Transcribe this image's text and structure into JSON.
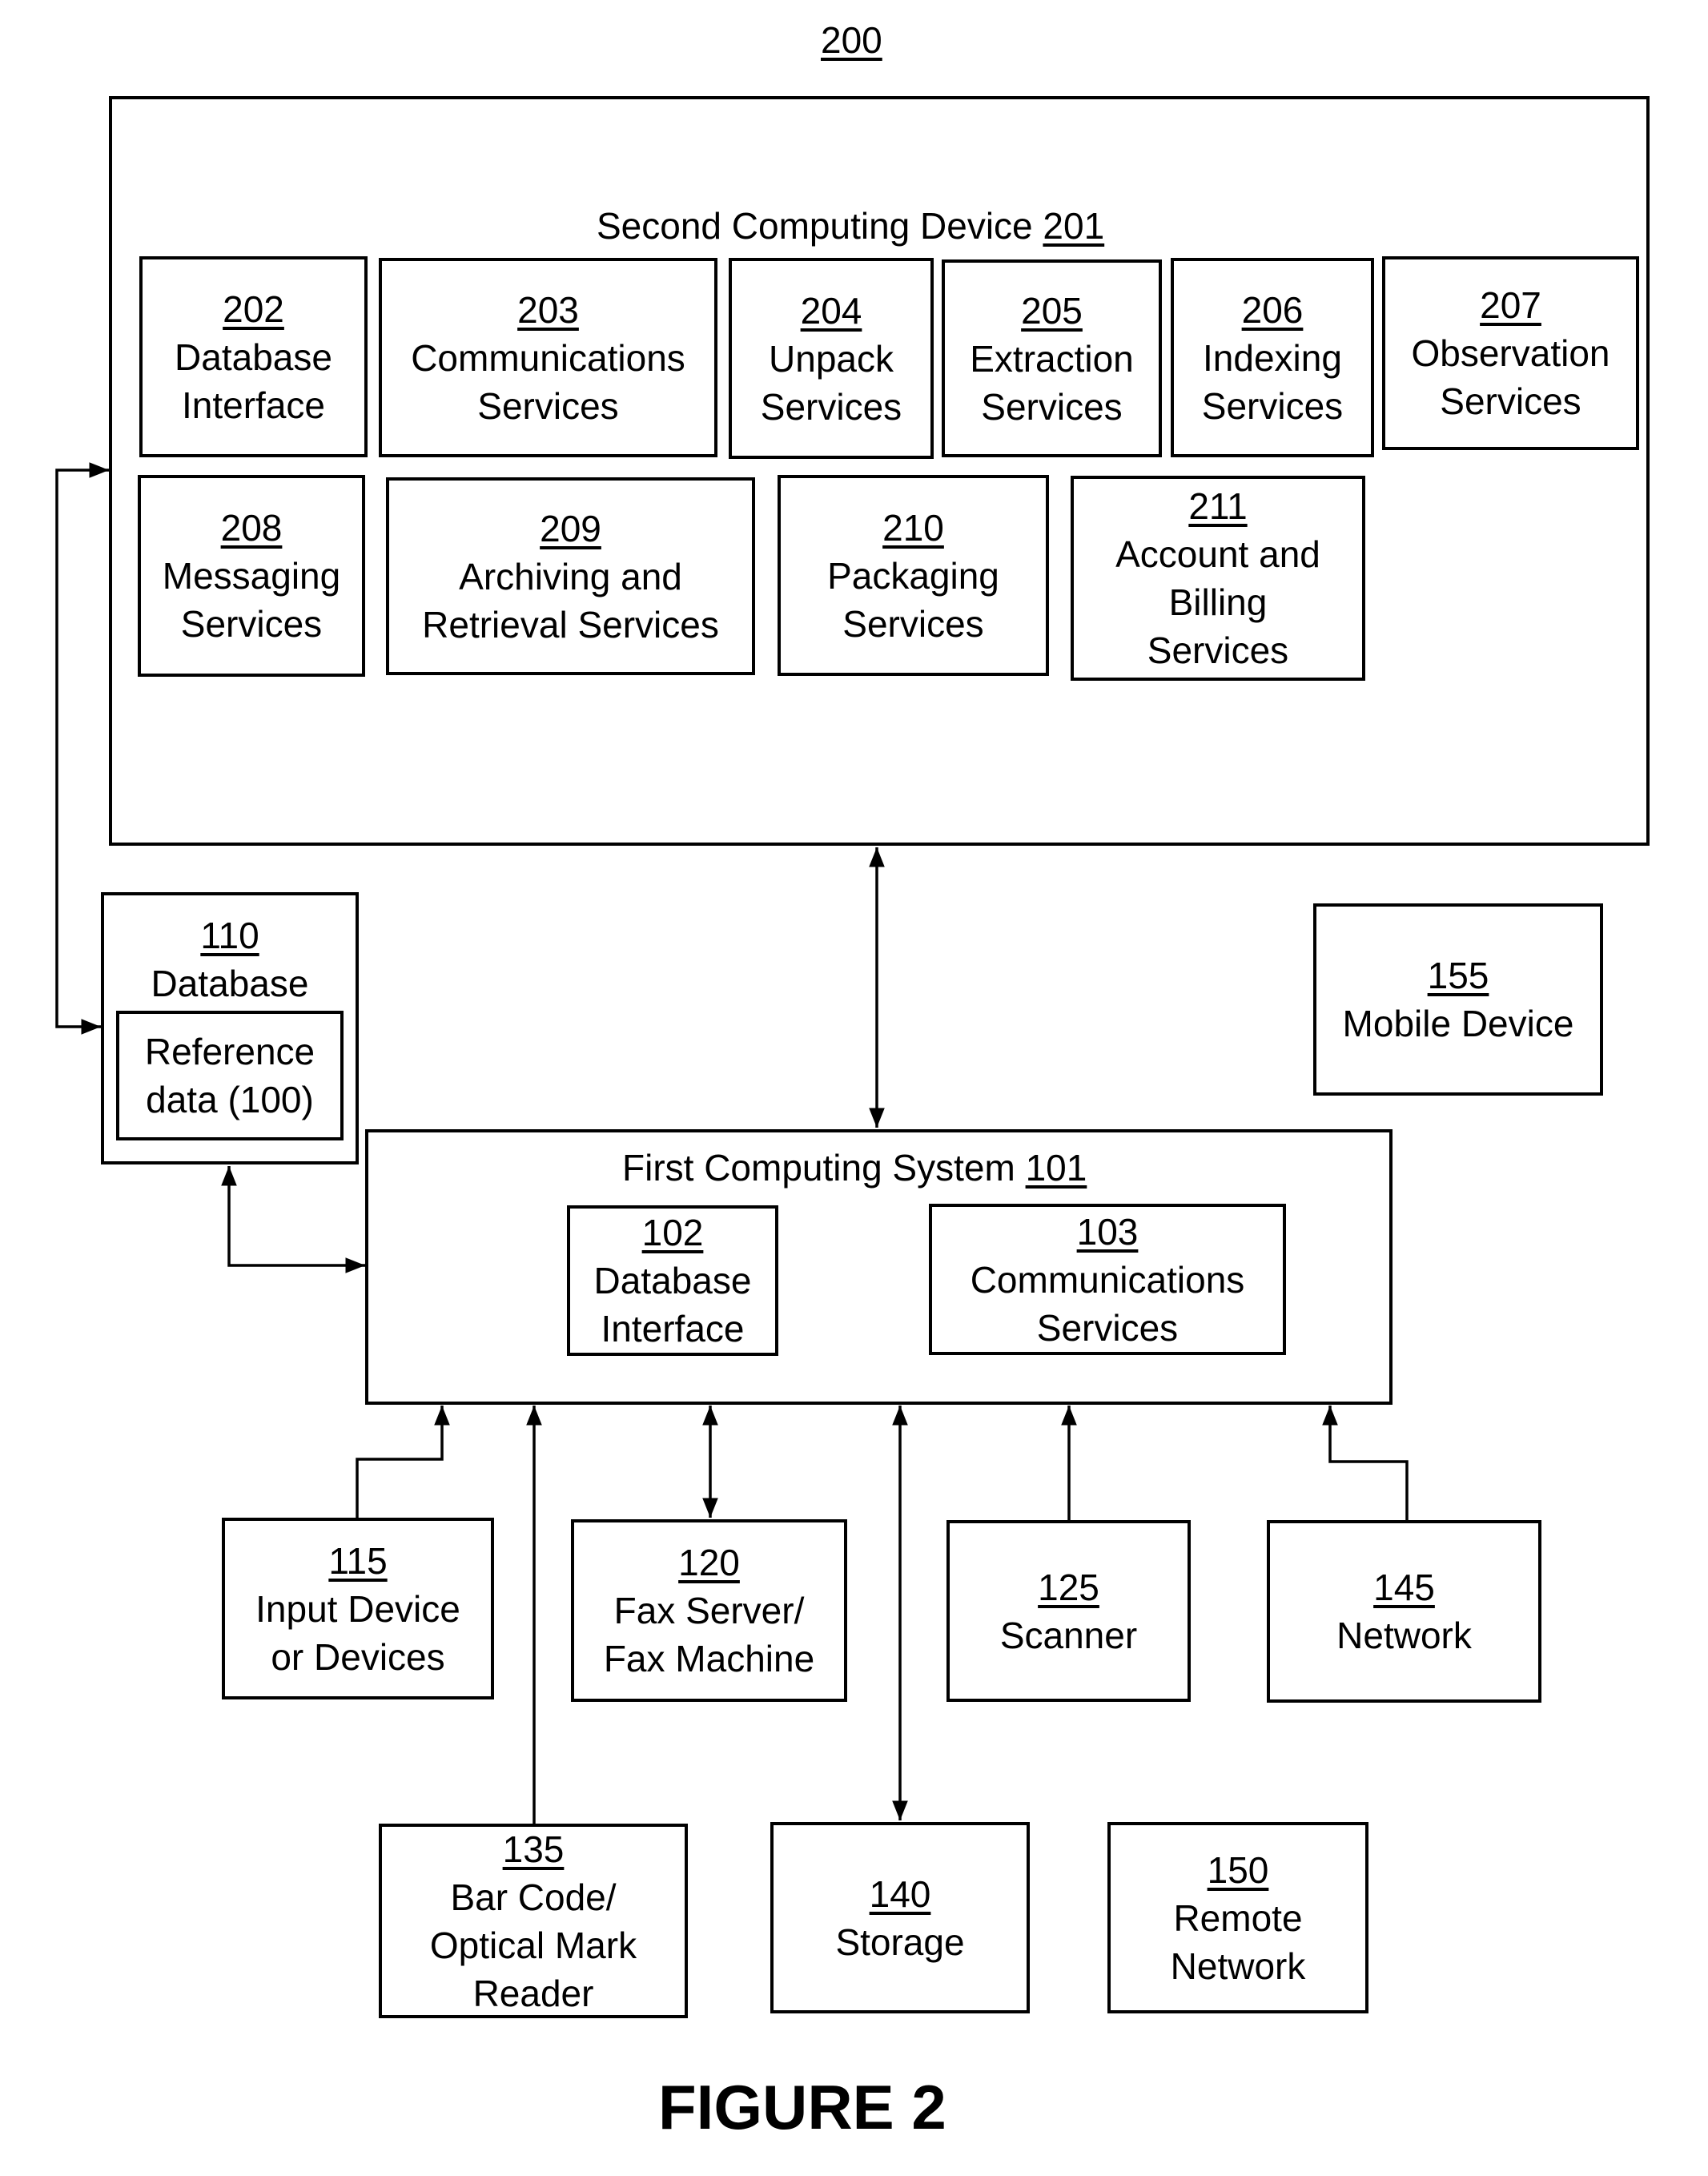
{
  "figure": {
    "ref": "200",
    "caption": "FIGURE 2"
  },
  "second_device": {
    "title": "Second Computing Device",
    "ref": "201",
    "modules": [
      {
        "ref": "202",
        "lines": [
          "Database",
          "Interface"
        ]
      },
      {
        "ref": "203",
        "lines": [
          "Communications",
          "Services"
        ]
      },
      {
        "ref": "204",
        "lines": [
          "Unpack",
          "Services"
        ]
      },
      {
        "ref": "205",
        "lines": [
          "Extraction",
          "Services"
        ]
      },
      {
        "ref": "206",
        "lines": [
          "Indexing",
          "Services"
        ]
      },
      {
        "ref": "207",
        "lines": [
          "Observation",
          "Services"
        ]
      },
      {
        "ref": "208",
        "lines": [
          "Messaging",
          "Services"
        ]
      },
      {
        "ref": "209",
        "lines": [
          "Archiving and",
          "Retrieval Services"
        ]
      },
      {
        "ref": "210",
        "lines": [
          "Packaging",
          "Services"
        ]
      },
      {
        "ref": "211",
        "lines": [
          "Account and",
          "Billing",
          "Services"
        ]
      }
    ]
  },
  "database": {
    "ref": "110",
    "label": "Database",
    "inner": {
      "lines": [
        "Reference",
        "data (100)"
      ]
    }
  },
  "mobile_device": {
    "ref": "155",
    "lines": [
      "Mobile Device"
    ]
  },
  "first_system": {
    "title": "First Computing System",
    "ref": "101",
    "modules": [
      {
        "ref": "102",
        "lines": [
          "Database",
          "Interface"
        ]
      },
      {
        "ref": "103",
        "lines": [
          "Communications",
          "Services"
        ]
      }
    ]
  },
  "peripherals": [
    {
      "ref": "115",
      "lines": [
        "Input Device",
        "or Devices"
      ],
      "link": "to-system"
    },
    {
      "ref": "120",
      "lines": [
        "Fax Server/",
        "Fax Machine"
      ],
      "link": "bidirectional"
    },
    {
      "ref": "125",
      "lines": [
        "Scanner"
      ],
      "link": "to-system"
    },
    {
      "ref": "145",
      "lines": [
        "Network"
      ],
      "link": "to-system"
    },
    {
      "ref": "135",
      "lines": [
        "Bar Code/",
        "Optical Mark",
        "Reader"
      ],
      "link": "to-system"
    },
    {
      "ref": "140",
      "lines": [
        "Storage"
      ],
      "link": "bidirectional"
    },
    {
      "ref": "150",
      "lines": [
        "Remote",
        "Network"
      ],
      "link": "none"
    }
  ],
  "connections": [
    {
      "from": "201",
      "to": "101",
      "type": "bidirectional"
    },
    {
      "from": "110",
      "to": "201",
      "type": "bidirectional"
    },
    {
      "from": "110",
      "to": "101",
      "type": "bidirectional"
    }
  ]
}
